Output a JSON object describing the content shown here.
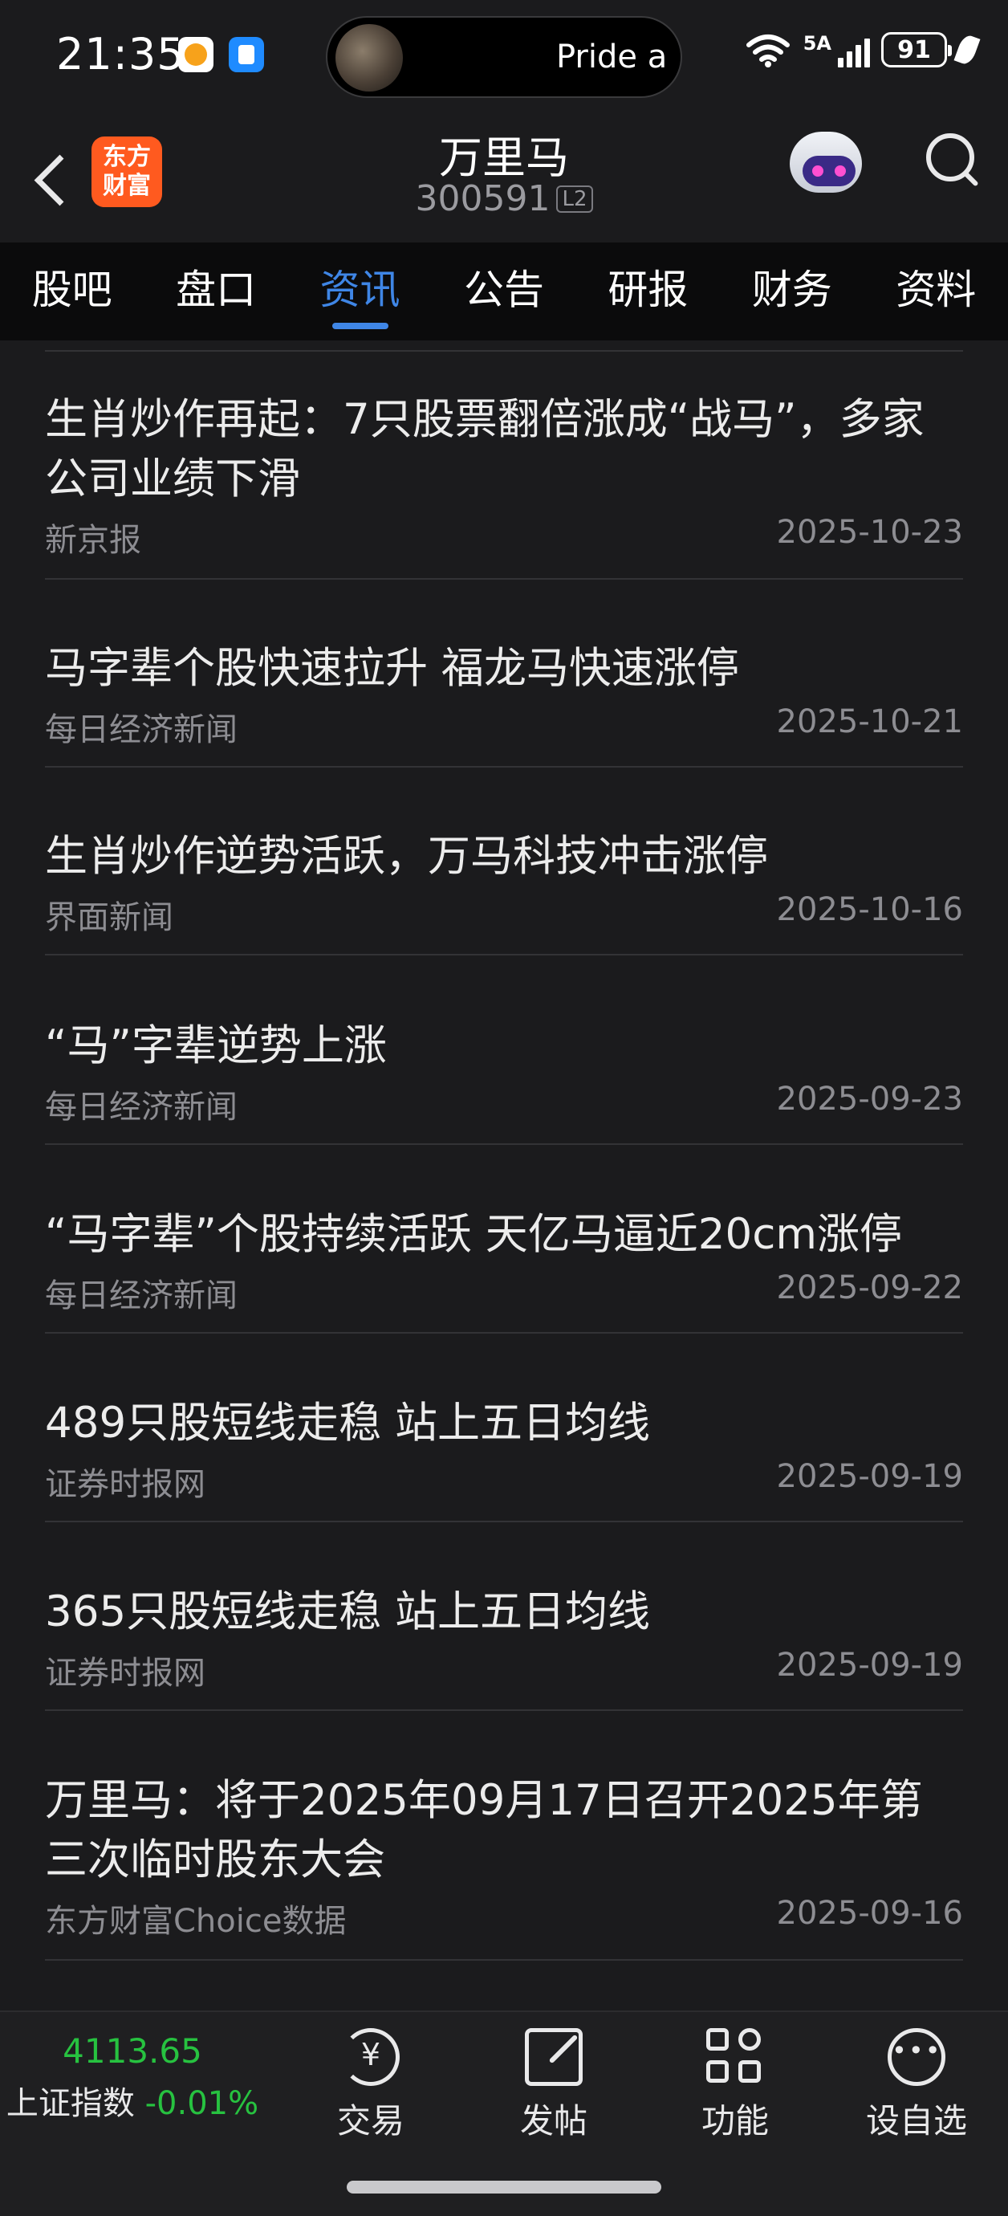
{
  "status_bar": {
    "time": "21:35",
    "media_title": "Pride a",
    "network_label": "5A",
    "battery": "91"
  },
  "header": {
    "brand_line1": "东方",
    "brand_line2": "财富",
    "stock_name": "万里马",
    "stock_code": "300591",
    "level_badge": "L2"
  },
  "tabs": [
    {
      "label": "股吧",
      "active": false
    },
    {
      "label": "盘口",
      "active": false
    },
    {
      "label": "资讯",
      "active": true
    },
    {
      "label": "公告",
      "active": false
    },
    {
      "label": "研报",
      "active": false
    },
    {
      "label": "财务",
      "active": false
    },
    {
      "label": "资料",
      "active": false
    }
  ],
  "news": [
    {
      "title": "生肖炒作再起：7只股票翻倍涨成“战马”，多家公司业绩下滑",
      "source": "新京报",
      "date": "2025-10-23"
    },
    {
      "title": "马字辈个股快速拉升 福龙马快速涨停",
      "source": "每日经济新闻",
      "date": "2025-10-21"
    },
    {
      "title": "生肖炒作逆势活跃，万马科技冲击涨停",
      "source": "界面新闻",
      "date": "2025-10-16"
    },
    {
      "title": "“马”字辈逆势上涨",
      "source": "每日经济新闻",
      "date": "2025-09-23"
    },
    {
      "title": "“马字辈”个股持续活跃 天亿马逼近20cm涨停",
      "source": "每日经济新闻",
      "date": "2025-09-22"
    },
    {
      "title": "489只股短线走稳 站上五日均线",
      "source": "证券时报网",
      "date": "2025-09-19"
    },
    {
      "title": "365只股短线走稳 站上五日均线",
      "source": "证券时报网",
      "date": "2025-09-19"
    },
    {
      "title": "万里马：将于2025年09月17日召开2025年第三次临时股东大会",
      "source": "东方财富Choice数据",
      "date": "2025-09-16"
    }
  ],
  "bottom_bar": {
    "index_value": "4113.65",
    "index_name": "上证指数",
    "index_change": "-0.01%",
    "trade_label": "交易",
    "trade_symbol": "¥",
    "post_label": "发帖",
    "function_label": "功能",
    "watchlist_label": "设自选"
  },
  "colors": {
    "accent": "#3f86e6",
    "down_green": "#27c240",
    "brand_orange": "#ff5a1f"
  }
}
